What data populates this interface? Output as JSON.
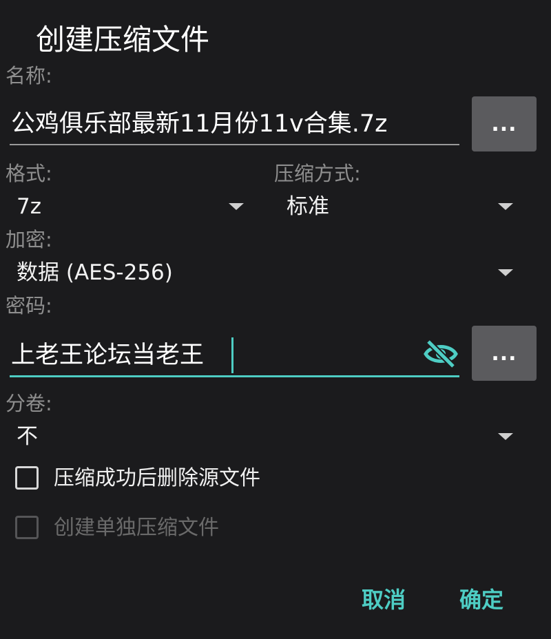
{
  "dialog": {
    "title": "创建压缩文件"
  },
  "name": {
    "label": "名称:",
    "value": "公鸡俱乐部最新11月份11v合集.7z",
    "browse_label": "..."
  },
  "format": {
    "label": "格式:",
    "value": "7z"
  },
  "compression": {
    "label": "压缩方式:",
    "value": "标准"
  },
  "encryption": {
    "label": "加密:",
    "value": "数据 (AES-256)"
  },
  "password": {
    "label": "密码:",
    "value": "上老王论坛当老王",
    "browse_label": "...",
    "visibility_icon": "eye-off-icon"
  },
  "split": {
    "label": "分卷:",
    "value": "不"
  },
  "options": {
    "delete_source": {
      "label": "压缩成功后删除源文件",
      "checked": false,
      "enabled": true
    },
    "separate_archives": {
      "label": "创建单独压缩文件",
      "checked": false,
      "enabled": false
    }
  },
  "actions": {
    "cancel_label": "取消",
    "ok_label": "确定"
  },
  "colors": {
    "accent": "#4ecdc4",
    "background": "#1b1b1d",
    "button": "#5b5b5e"
  }
}
